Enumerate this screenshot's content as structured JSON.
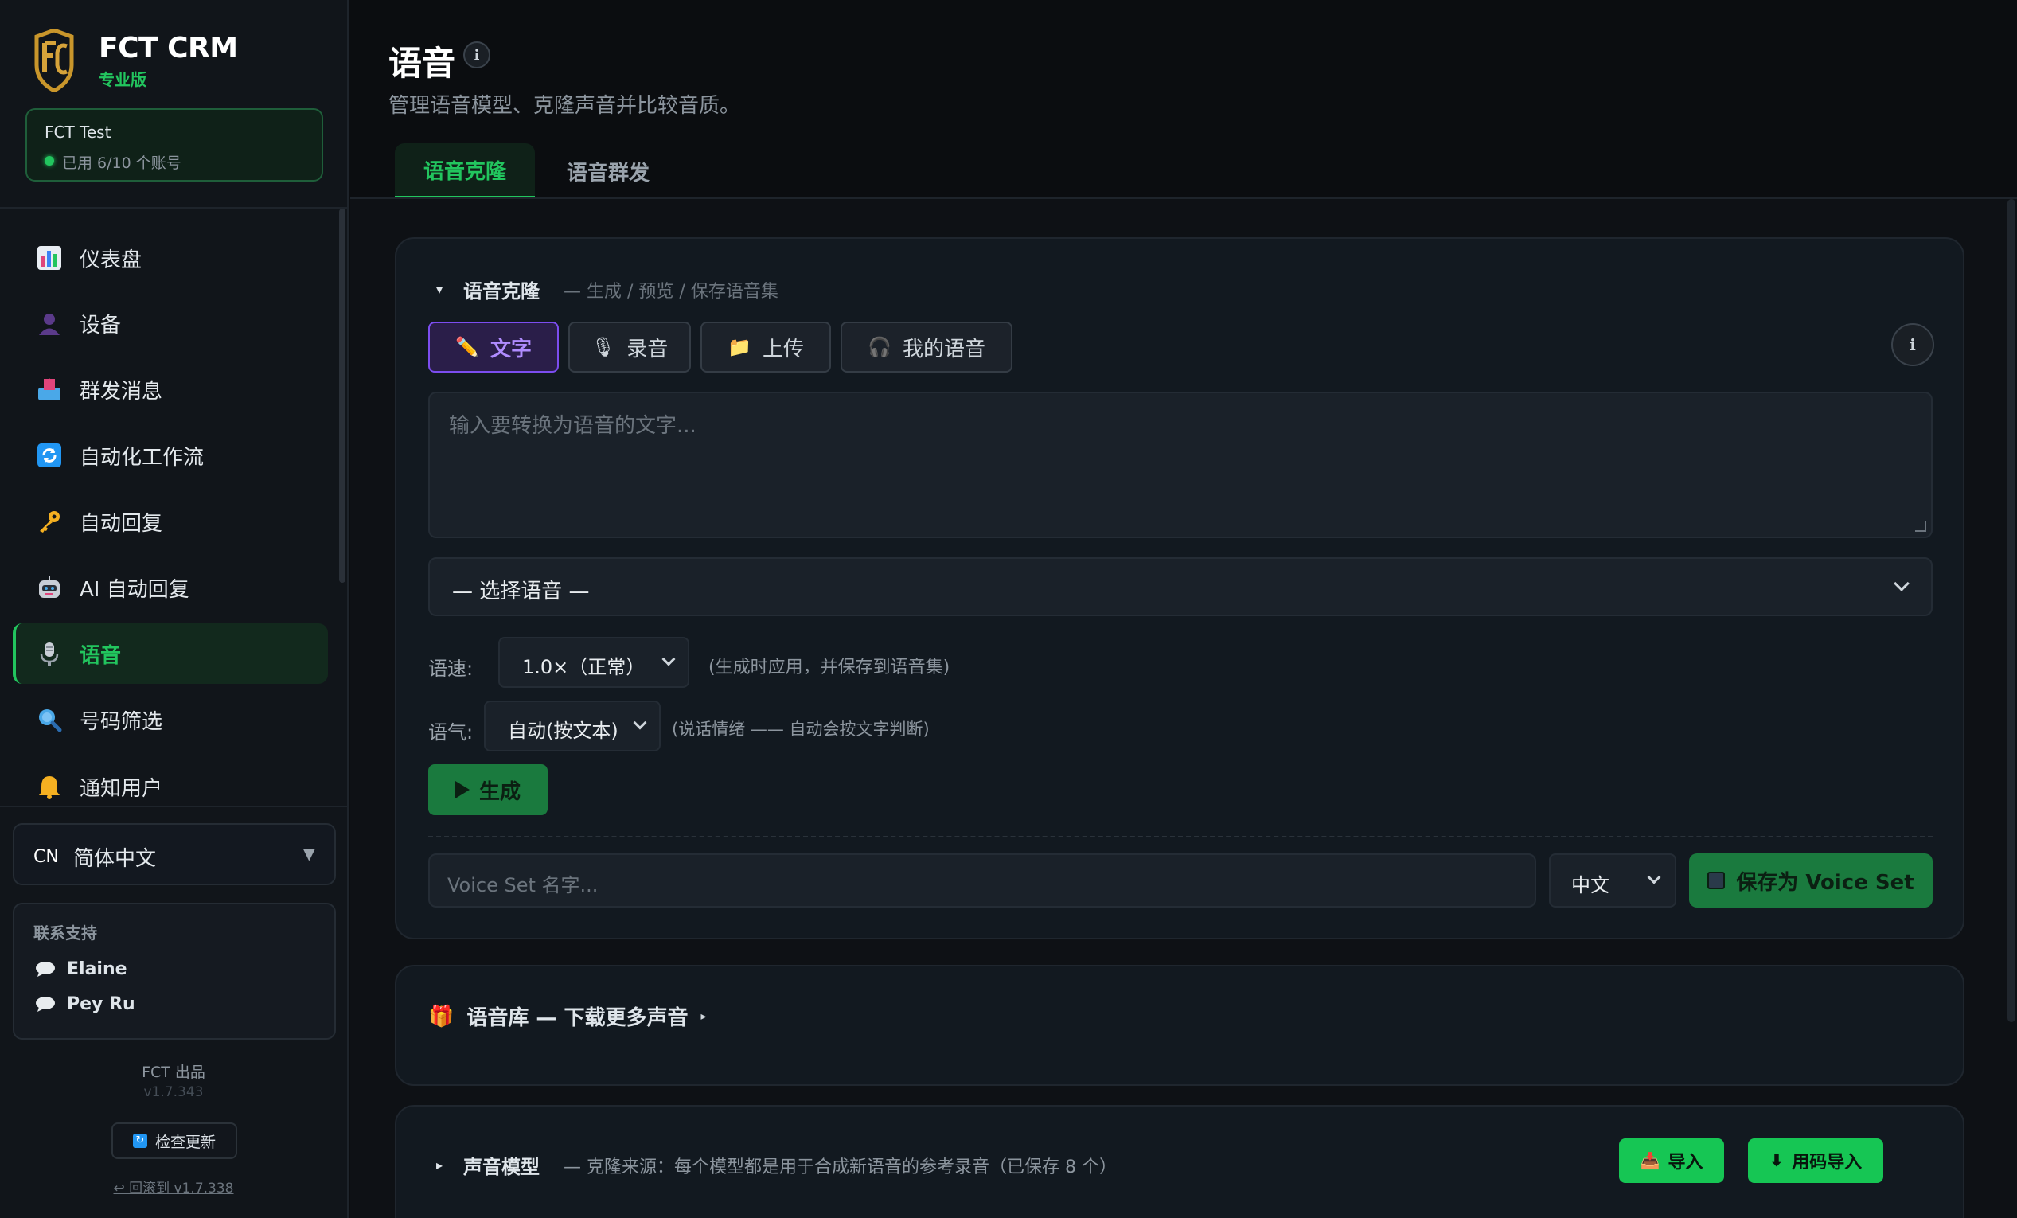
{
  "app": {
    "name": "FCT CRM",
    "edition": "专业版"
  },
  "account": {
    "name": "FCT Test",
    "usage": "已用 6/10 个账号"
  },
  "nav": {
    "items": [
      {
        "label": "仪表盘",
        "icon": "bar-chart-icon"
      },
      {
        "label": "设备",
        "icon": "user-silhouette-icon"
      },
      {
        "label": "群发消息",
        "icon": "outbox-tray-icon"
      },
      {
        "label": "自动化工作流",
        "icon": "refresh-arrows-icon"
      },
      {
        "label": "自动回复",
        "icon": "key-icon"
      },
      {
        "label": "AI 自动回复",
        "icon": "robot-icon"
      },
      {
        "label": "语音",
        "icon": "microphone-icon",
        "active": true
      },
      {
        "label": "号码筛选",
        "icon": "magnifier-icon"
      },
      {
        "label": "通知用户",
        "icon": "bell-icon"
      }
    ]
  },
  "language": {
    "code": "CN",
    "label": "简体中文",
    "caret": "▼"
  },
  "support": {
    "title": "联系支持",
    "contacts": [
      "Elaine",
      "Pey Ru"
    ]
  },
  "footer": {
    "made_by": "FCT 出品",
    "version": "v1.7.343",
    "check_update": "检查更新",
    "rollback": "↩ 回滚到 v1.7.338"
  },
  "page": {
    "title": "语音",
    "subtitle": "管理语音模型、克隆声音并比较音质。",
    "info": "i"
  },
  "tabs": [
    {
      "label": "语音克隆",
      "active": true
    },
    {
      "label": "语音群发",
      "active": false
    }
  ],
  "clone": {
    "toggle": "▾",
    "title": "语音克隆",
    "subtitle": "— 生成 / 预览 / 保存语音集",
    "modes": [
      {
        "label": "文字",
        "icon": "pencil-icon",
        "glyph": "✏️",
        "active": true
      },
      {
        "label": "录音",
        "icon": "microphone-icon",
        "glyph": "🎙",
        "active": false
      },
      {
        "label": "上传",
        "icon": "folder-icon",
        "glyph": "📁",
        "active": false
      },
      {
        "label": "我的语音",
        "icon": "headphones-icon",
        "glyph": "🎧",
        "active": false
      }
    ],
    "info": "i",
    "text_placeholder": "输入要转换为语音的文字...",
    "voice_select": "— 选择语音 —",
    "speed_label": "语速:",
    "speed_value": "1.0×（正常）",
    "speed_hint": "(生成时应用，并保存到语音集)",
    "tone_label": "语气:",
    "tone_value": "自动(按文本)",
    "tone_hint": "(说话情绪 —— 自动会按文字判断)",
    "generate": "生成",
    "name_placeholder": "Voice Set 名字...",
    "lang_value": "中文",
    "save": "保存为 Voice Set"
  },
  "library": {
    "icon": "gift-icon",
    "glyph": "🎁",
    "title": "语音库 — 下载更多声音",
    "arrow": "▸"
  },
  "models": {
    "toggle": "▸",
    "title": "声音模型",
    "subtitle": "— 克隆来源：每个模型都是用于合成新语音的参考录音（已保存 8 个）",
    "import": "导入",
    "code_import": "用码导入"
  },
  "colors": {
    "accent": "#22c55e",
    "purple": "#7c4df0",
    "bg": "#0b0d10"
  }
}
